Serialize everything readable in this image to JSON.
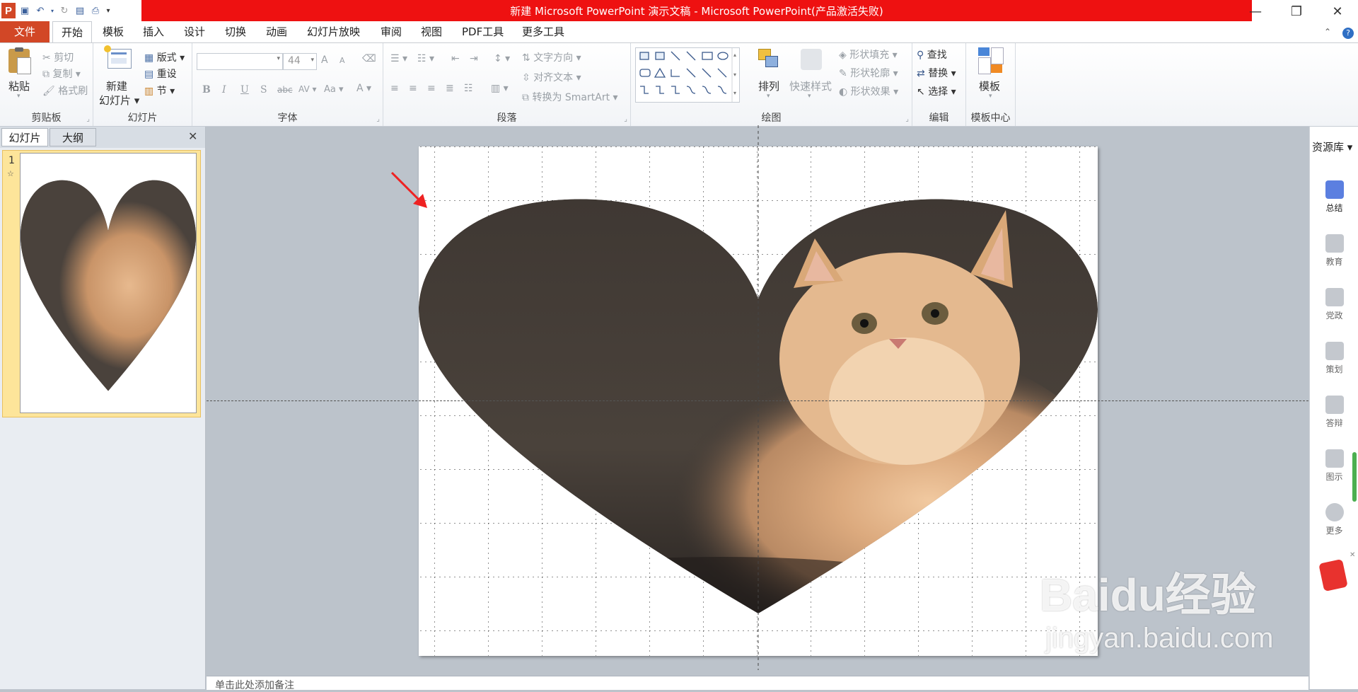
{
  "window": {
    "title": "新建 Microsoft PowerPoint 演示文稿 - Microsoft PowerPoint(产品激活失败)",
    "app_icon_letter": "P"
  },
  "tabs": [
    "文件",
    "开始",
    "模板",
    "插入",
    "设计",
    "切换",
    "动画",
    "幻灯片放映",
    "审阅",
    "视图",
    "PDF工具",
    "更多工具"
  ],
  "ribbon": {
    "clipboard": {
      "label": "剪贴板",
      "paste": "粘贴",
      "cut": "剪切",
      "copy": "复制",
      "format_painter": "格式刷"
    },
    "slides": {
      "label": "幻灯片",
      "new_slide_1": "新建",
      "new_slide_2": "幻灯片",
      "layout": "版式",
      "reset": "重设",
      "section": "节"
    },
    "font": {
      "label": "字体",
      "font_name": "",
      "font_size": "44",
      "grow": "A",
      "shrink": "A",
      "bold": "B",
      "italic": "I",
      "underline": "U",
      "shadow": "S",
      "strike": "abc",
      "spacing": "AV",
      "case": "Aa",
      "color": "A"
    },
    "paragraph": {
      "label": "段落",
      "text_direction": "文字方向",
      "align_text": "对齐文本",
      "smartart": "转换为 SmartArt"
    },
    "drawing": {
      "label": "绘图",
      "arrange": "排列",
      "quick_styles": "快速样式",
      "shape_fill": "形状填充",
      "shape_outline": "形状轮廓",
      "shape_effects": "形状效果"
    },
    "editing": {
      "label": "编辑",
      "find": "查找",
      "replace": "替换",
      "select": "选择"
    },
    "template_center": {
      "label": "模板中心",
      "template": "模板"
    }
  },
  "left_pane": {
    "tabs": [
      "幻灯片",
      "大纲"
    ],
    "slide_number": "1"
  },
  "right_panel": {
    "title": "资源库",
    "items": [
      "总结",
      "教育",
      "党政",
      "策划",
      "答辩",
      "图示",
      "更多"
    ]
  },
  "notes": {
    "placeholder": "单击此处添加备注"
  },
  "watermark": {
    "brand": "Baidu经验",
    "url": "jingyan.baidu.com"
  },
  "colors": {
    "title_bar": "#ee1111",
    "file_tab": "#d24726",
    "thumb_selection": "#fde59a",
    "annotation_arrow": "#ee2222"
  }
}
